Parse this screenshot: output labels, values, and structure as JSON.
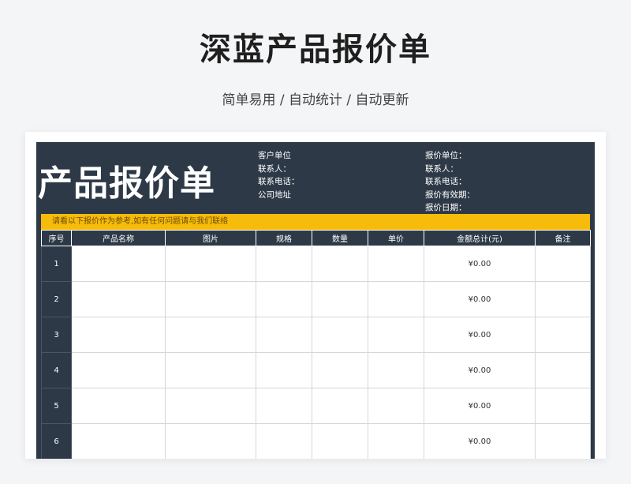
{
  "header": {
    "title": "深蓝产品报价单",
    "subtitle": "简单易用 / 自动统计 / 自动更新"
  },
  "sheet": {
    "title": "产品报价单",
    "customer_info": [
      "客户单位",
      "联系人：",
      "联系电话：",
      "公司地址"
    ],
    "quote_info": [
      "报价单位：",
      "联系人：",
      "联系电话：",
      "报价有效期：",
      "报价日期："
    ],
    "notice": "请看以下报价作为参考,如有任何问题请与我们联络",
    "columns": [
      "序号",
      "产品名称",
      "图片",
      "规格",
      "数量",
      "单价",
      "金额总计(元)",
      "备注"
    ],
    "rows": [
      {
        "index": "1",
        "total": "¥0.00"
      },
      {
        "index": "2",
        "total": "¥0.00"
      },
      {
        "index": "3",
        "total": "¥0.00"
      },
      {
        "index": "4",
        "total": "¥0.00"
      },
      {
        "index": "5",
        "total": "¥0.00"
      },
      {
        "index": "6",
        "total": "¥0.00"
      }
    ]
  },
  "colors": {
    "header_bg": "#2d3947",
    "notice_bg": "#f7bb0b",
    "page_bg": "#f4f5f7"
  }
}
